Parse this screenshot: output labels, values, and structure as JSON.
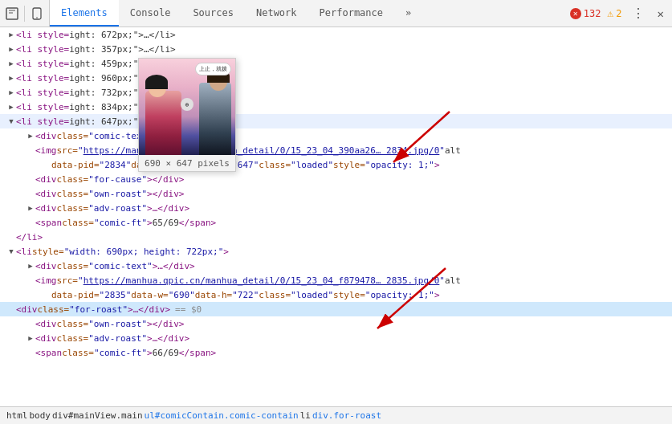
{
  "toolbar": {
    "inspect_label": "Inspect",
    "device_label": "Device",
    "tabs": [
      {
        "id": "elements",
        "label": "Elements",
        "active": true
      },
      {
        "id": "console",
        "label": "Console",
        "active": false
      },
      {
        "id": "sources",
        "label": "Sources",
        "active": false
      },
      {
        "id": "network",
        "label": "Network",
        "active": false
      },
      {
        "id": "performance",
        "label": "Performance",
        "active": false
      },
      {
        "id": "more",
        "label": "»",
        "active": false
      }
    ],
    "error_count": "132",
    "warn_count": "2",
    "more_label": "⋮",
    "close_label": "✕"
  },
  "code": {
    "lines": [
      {
        "id": 1,
        "indent": 4,
        "arrow": "collapsed",
        "content": "<li style=",
        "suffix": "ight: 672px;\">…</li>"
      },
      {
        "id": 2,
        "indent": 4,
        "arrow": "collapsed",
        "content": "<li style=",
        "suffix": "ight: 357px;\">…</li>"
      },
      {
        "id": 3,
        "indent": 4,
        "arrow": "collapsed",
        "content": "<li style=",
        "suffix": "ight: 459px;\">…</li>"
      },
      {
        "id": 4,
        "indent": 4,
        "arrow": "collapsed",
        "content": "<li style=",
        "suffix": "ight: 960px;\">…</li>"
      },
      {
        "id": 5,
        "indent": 4,
        "arrow": "collapsed",
        "content": "<li style=",
        "suffix": "ight: 732px;\">…</li>"
      },
      {
        "id": 6,
        "indent": 4,
        "arrow": "collapsed",
        "content": "<li style=",
        "suffix": "ight: 834px;\">…</li>"
      },
      {
        "id": 7,
        "indent": 4,
        "arrow": "collapsed",
        "content": "<li style=",
        "suffix": "ight: 647px;\">"
      },
      {
        "id": 8,
        "indent": 6,
        "arrow": "collapsed",
        "content": "<div class=\"comic-text\">…</div>"
      },
      {
        "id": 9,
        "indent": 6,
        "arrow": "leaf",
        "content": "<img src=\"https://manhua.qpic.cn/manhua_detail/0/15_23_04_390aa26… 2834.jpg/0\" alt",
        "suffix": ""
      },
      {
        "id": 10,
        "indent": 10,
        "content": "data-pid=\"2834\" data-w=\"690\" data-h=\"647\" class=\"loaded\" style=\"opacity: 1;\">"
      },
      {
        "id": 11,
        "indent": 6,
        "arrow": "leaf",
        "content": "<div class=\"for-cause\"></div>"
      },
      {
        "id": 12,
        "indent": 6,
        "arrow": "leaf",
        "content": "<div class=\"own-roast\"></div>"
      },
      {
        "id": 13,
        "indent": 6,
        "arrow": "collapsed",
        "content": "<div class=\"adv-roast\">…</div>"
      },
      {
        "id": 14,
        "indent": 6,
        "arrow": "leaf",
        "content": "<span class=\"comic-ft\">65/69</span>"
      },
      {
        "id": 15,
        "indent": 4,
        "arrow": "leaf",
        "content": "</li>"
      },
      {
        "id": 16,
        "indent": 4,
        "arrow": "expanded",
        "content": "<li style=\"width: 690px; height: 722px;\">"
      },
      {
        "id": 17,
        "indent": 6,
        "arrow": "collapsed",
        "content": "<div class=\"comic-text\">…</div>"
      },
      {
        "id": 18,
        "indent": 6,
        "arrow": "leaf",
        "content": "<img src=\"https://manhua.qpic.cn/manhua_detail/0/15_23_04_f879478… 2835.jpg/0\" alt",
        "suffix": ""
      },
      {
        "id": 19,
        "indent": 10,
        "content": "data-pid=\"2835\" data-w=\"690\" data-h=\"722\" class=\"loaded\" style=\"opacity: 1;\">"
      },
      {
        "id": 20,
        "indent": 6,
        "arrow": "collapsed",
        "content": "<div class=\"for-roast\">…</div>",
        "suffix": " == $0",
        "selected": true
      },
      {
        "id": 21,
        "indent": 6,
        "arrow": "leaf",
        "content": "<div class=\"own-roast\"></div>"
      },
      {
        "id": 22,
        "indent": 6,
        "arrow": "collapsed",
        "content": "<div class=\"adv-roast\">…</div>"
      },
      {
        "id": 23,
        "indent": 6,
        "arrow": "leaf",
        "content": "<span class=\"comic-ft\">66/69</span>"
      }
    ]
  },
  "image_preview": {
    "size_label": "690 × 647 pixels",
    "speech_bubble_text": "上止，就拨"
  },
  "breadcrumb": {
    "items": [
      {
        "label": "html",
        "highlight": false
      },
      {
        "label": "body",
        "highlight": false
      },
      {
        "label": "div#mainView.main",
        "highlight": false
      },
      {
        "label": "ul#comicContain.comic-contain",
        "highlight": true
      },
      {
        "label": "li",
        "highlight": false
      },
      {
        "label": "div.for-roast",
        "highlight": true
      }
    ]
  }
}
